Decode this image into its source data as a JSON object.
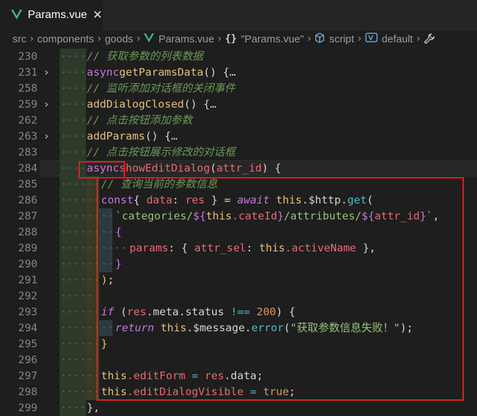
{
  "tab": {
    "title": "Params.vue",
    "icon": "vue-icon",
    "close_glyph": "✕"
  },
  "breadcrumb": {
    "items": [
      "src",
      "components",
      "goods",
      "Params.vue",
      "\"Params.vue\"",
      "script",
      "default"
    ],
    "braces": "{}",
    "sep": "›"
  },
  "colors": {
    "highlight_box": "#e02020",
    "background": "#1e1e1e"
  },
  "lines": [
    {
      "n": "230",
      "fold": "",
      "t": [
        "// 获取参数的列表数据"
      ]
    },
    {
      "n": "231",
      "fold": "›",
      "t": [
        "async",
        "getParamsData",
        "() {",
        "…"
      ]
    },
    {
      "n": "258",
      "fold": "",
      "t": [
        "// 监听添加对话框的关闭事件"
      ]
    },
    {
      "n": "259",
      "fold": "›",
      "t": [
        "addDialogClosed",
        "() {",
        "…"
      ]
    },
    {
      "n": "262",
      "fold": "",
      "t": [
        "// 点击按钮添加参数"
      ]
    },
    {
      "n": "263",
      "fold": "›",
      "t": [
        "addParams",
        "() {",
        "…"
      ]
    },
    {
      "n": "283",
      "fold": "",
      "t": [
        "// 点击按钮展示修改的对话框"
      ]
    },
    {
      "n": "284",
      "fold": "",
      "t": [
        "async",
        "showEditDialog",
        "(",
        "attr_id",
        ") {"
      ]
    },
    {
      "n": "285",
      "fold": "",
      "t": [
        "// 查询当前的参数信息"
      ]
    },
    {
      "n": "286",
      "fold": "",
      "t": [
        "const",
        "{ ",
        "data",
        ": ",
        "res",
        " } = ",
        "await",
        " ",
        "this",
        ".$http.",
        "get",
        "("
      ]
    },
    {
      "n": "287",
      "fold": "",
      "t": [
        "`categories/",
        "${",
        "this",
        ".cateId",
        "}",
        "/attributes/",
        "${",
        "attr_id",
        "}",
        "`",
        ","
      ]
    },
    {
      "n": "288",
      "fold": "",
      "t": [
        "{"
      ]
    },
    {
      "n": "289",
      "fold": "",
      "t": [
        "params",
        ": { ",
        "attr_sel",
        ": ",
        "this",
        ".activeName",
        " },"
      ]
    },
    {
      "n": "290",
      "fold": "",
      "t": [
        "}"
      ]
    },
    {
      "n": "291",
      "fold": "",
      "t": [
        ")",
        ";"
      ]
    },
    {
      "n": "292",
      "fold": "",
      "t": []
    },
    {
      "n": "293",
      "fold": "",
      "t": [
        "if",
        " (",
        "res",
        ".meta.status ",
        "!==",
        " ",
        "200",
        ") {"
      ]
    },
    {
      "n": "294",
      "fold": "",
      "t": [
        "return",
        " ",
        "this",
        ".$message.",
        "error",
        "(",
        "\"获取参数信息失败！\"",
        ");"
      ]
    },
    {
      "n": "295",
      "fold": "",
      "t": [
        "}"
      ]
    },
    {
      "n": "296",
      "fold": "",
      "t": []
    },
    {
      "n": "297",
      "fold": "",
      "t": [
        "this",
        ".editForm ",
        "=",
        " ",
        "res",
        ".data;"
      ]
    },
    {
      "n": "298",
      "fold": "",
      "t": [
        "this",
        ".editDialogVisible ",
        "=",
        " ",
        "true",
        ";"
      ]
    },
    {
      "n": "299",
      "fold": "",
      "t": [
        "}",
        ","
      ]
    }
  ]
}
